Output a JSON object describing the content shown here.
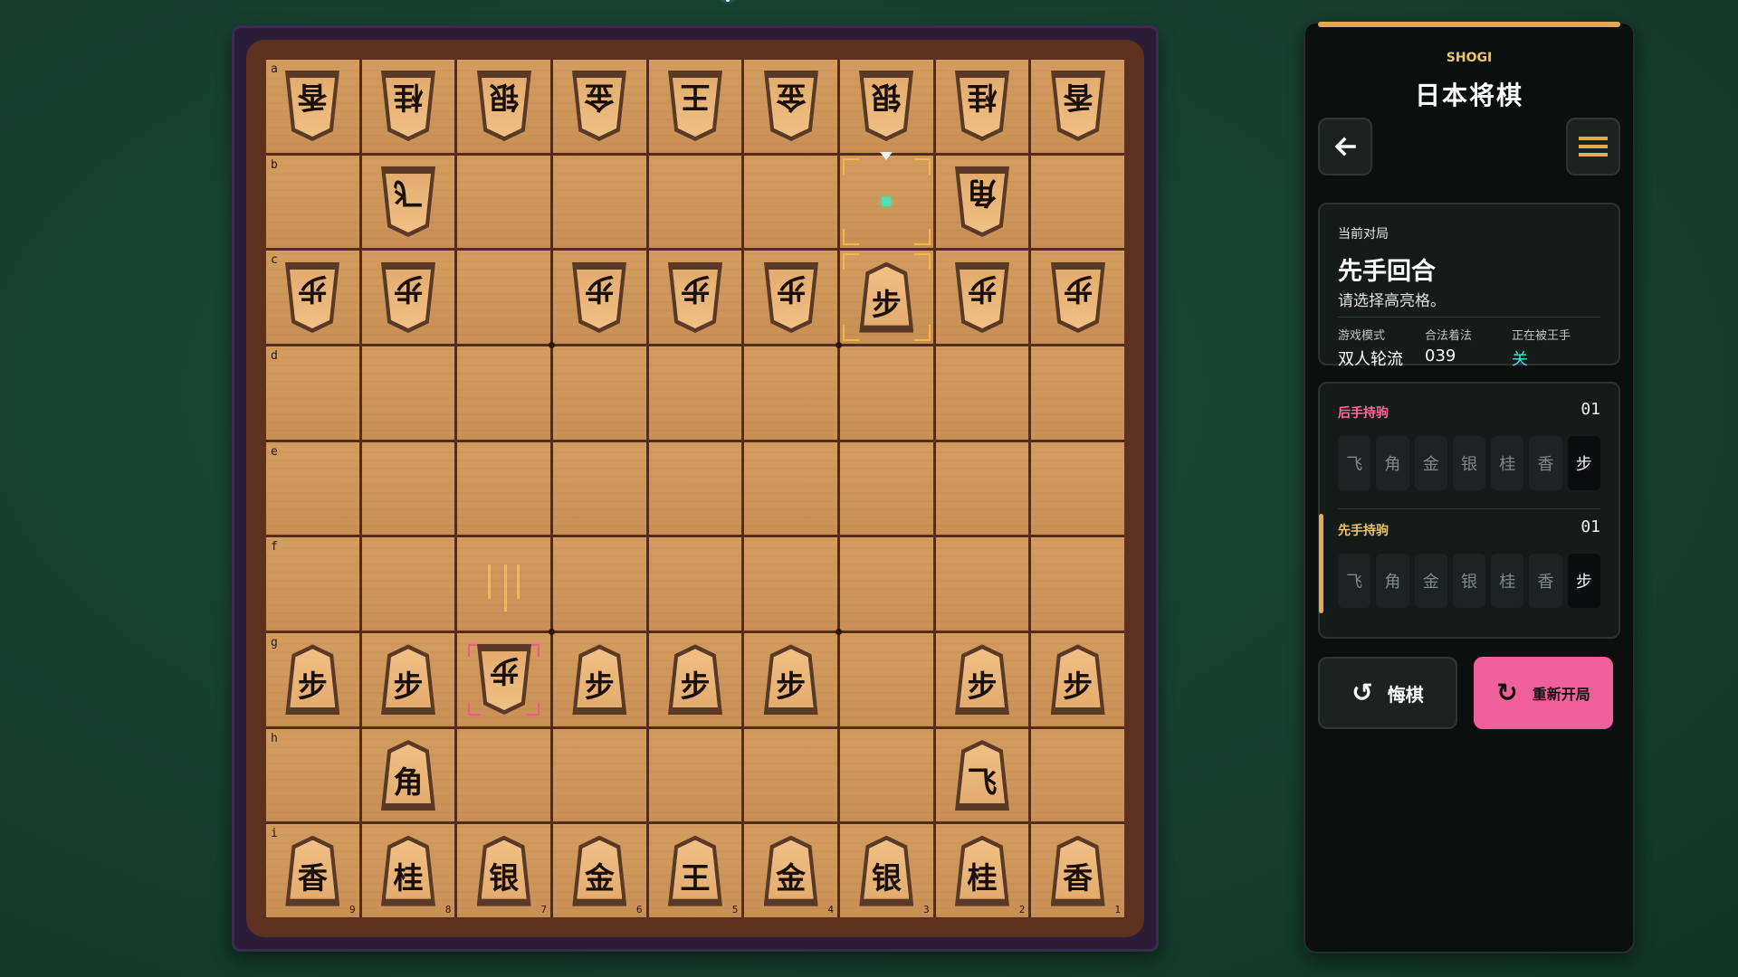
{
  "colors": {
    "accent": "#e8a84c",
    "highlight_teal": "#48e0d0",
    "restart_pink": "#f0609a",
    "gote_label": "#ff6b9f",
    "sente_label": "#f0c46a"
  },
  "board": {
    "row_labels": [
      "a",
      "b",
      "c",
      "d",
      "e",
      "f",
      "g",
      "h",
      "i"
    ],
    "col_labels": [
      "9",
      "8",
      "7",
      "6",
      "5",
      "4",
      "3",
      "2",
      "1"
    ],
    "pieces": [
      {
        "r": 0,
        "c": 0,
        "k": "香",
        "o": "gote"
      },
      {
        "r": 0,
        "c": 1,
        "k": "桂",
        "o": "gote"
      },
      {
        "r": 0,
        "c": 2,
        "k": "银",
        "o": "gote"
      },
      {
        "r": 0,
        "c": 3,
        "k": "金",
        "o": "gote"
      },
      {
        "r": 0,
        "c": 4,
        "k": "王",
        "o": "gote"
      },
      {
        "r": 0,
        "c": 5,
        "k": "金",
        "o": "gote"
      },
      {
        "r": 0,
        "c": 6,
        "k": "银",
        "o": "gote"
      },
      {
        "r": 0,
        "c": 7,
        "k": "桂",
        "o": "gote"
      },
      {
        "r": 0,
        "c": 8,
        "k": "香",
        "o": "gote"
      },
      {
        "r": 1,
        "c": 1,
        "k": "飞",
        "o": "gote"
      },
      {
        "r": 1,
        "c": 7,
        "k": "角",
        "o": "gote"
      },
      {
        "r": 2,
        "c": 0,
        "k": "步",
        "o": "gote"
      },
      {
        "r": 2,
        "c": 1,
        "k": "步",
        "o": "gote"
      },
      {
        "r": 2,
        "c": 3,
        "k": "步",
        "o": "gote"
      },
      {
        "r": 2,
        "c": 4,
        "k": "步",
        "o": "gote"
      },
      {
        "r": 2,
        "c": 5,
        "k": "步",
        "o": "gote"
      },
      {
        "r": 2,
        "c": 6,
        "k": "步",
        "o": "sente"
      },
      {
        "r": 2,
        "c": 7,
        "k": "步",
        "o": "gote"
      },
      {
        "r": 2,
        "c": 8,
        "k": "步",
        "o": "gote"
      },
      {
        "r": 6,
        "c": 0,
        "k": "步",
        "o": "sente"
      },
      {
        "r": 6,
        "c": 1,
        "k": "步",
        "o": "sente"
      },
      {
        "r": 6,
        "c": 2,
        "k": "步",
        "o": "gote"
      },
      {
        "r": 6,
        "c": 3,
        "k": "步",
        "o": "sente"
      },
      {
        "r": 6,
        "c": 4,
        "k": "步",
        "o": "sente"
      },
      {
        "r": 6,
        "c": 5,
        "k": "步",
        "o": "sente"
      },
      {
        "r": 6,
        "c": 7,
        "k": "步",
        "o": "sente"
      },
      {
        "r": 6,
        "c": 8,
        "k": "步",
        "o": "sente"
      },
      {
        "r": 7,
        "c": 1,
        "k": "角",
        "o": "sente"
      },
      {
        "r": 7,
        "c": 7,
        "k": "飞",
        "o": "sente"
      },
      {
        "r": 8,
        "c": 0,
        "k": "香",
        "o": "sente"
      },
      {
        "r": 8,
        "c": 1,
        "k": "桂",
        "o": "sente"
      },
      {
        "r": 8,
        "c": 2,
        "k": "银",
        "o": "sente"
      },
      {
        "r": 8,
        "c": 3,
        "k": "金",
        "o": "sente"
      },
      {
        "r": 8,
        "c": 4,
        "k": "王",
        "o": "sente"
      },
      {
        "r": 8,
        "c": 5,
        "k": "金",
        "o": "sente"
      },
      {
        "r": 8,
        "c": 6,
        "k": "银",
        "o": "sente"
      },
      {
        "r": 8,
        "c": 7,
        "k": "桂",
        "o": "sente"
      },
      {
        "r": 8,
        "c": 8,
        "k": "香",
        "o": "sente"
      }
    ],
    "selected": [
      {
        "r": 1,
        "c": 6
      },
      {
        "r": 2,
        "c": 6
      }
    ],
    "legal_moves": [
      {
        "r": 1,
        "c": 6
      }
    ],
    "last_move": {
      "r": 6,
      "c": 2
    },
    "cursor": {
      "r": 0,
      "c": 6
    }
  },
  "panel": {
    "brand": "SHOGI",
    "title": "日本将棋",
    "back_icon": "arrow-left-icon",
    "menu_icon": "hamburger-menu-icon",
    "game": {
      "label": "当前对局",
      "heading": "先手回合",
      "subtitle": "请选择高亮格。",
      "stats": [
        {
          "key": "游戏模式",
          "value": "双人轮流"
        },
        {
          "key": "合法着法",
          "value": "039"
        },
        {
          "key": "正在被王手",
          "value": "关"
        }
      ]
    },
    "hands": {
      "gote": {
        "title": "后手持驹",
        "count": "01"
      },
      "sente": {
        "title": "先手持驹",
        "count": "01"
      },
      "piece_types": [
        "飞",
        "角",
        "金",
        "银",
        "桂",
        "香",
        "步"
      ],
      "held": [
        "步"
      ]
    },
    "undo_label": "悔棋",
    "undo_icon": "undo-arrow-icon",
    "restart_label": "重新开局",
    "restart_icon": "restart-circle-icon"
  }
}
